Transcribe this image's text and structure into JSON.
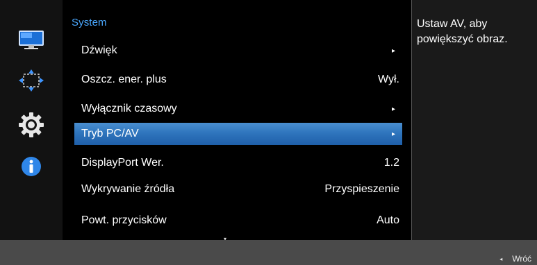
{
  "menu": {
    "title": "System",
    "items": [
      {
        "label": "Dźwięk",
        "value": "",
        "arrow": "▸"
      },
      {
        "label": "Oszcz. ener. plus",
        "value": "Wył.",
        "arrow": ""
      },
      {
        "label": "Wyłącznik czasowy",
        "value": "",
        "arrow": "▸"
      },
      {
        "label": "Tryb PC/AV",
        "value": "",
        "arrow": "▸",
        "selected": true
      },
      {
        "label": "DisplayPort Wer.",
        "value": "1.2",
        "arrow": ""
      },
      {
        "label": "Wykrywanie źródła",
        "value": "Przyspieszenie",
        "arrow": ""
      },
      {
        "label": "Powt. przycisków",
        "value": "Auto",
        "arrow": ""
      }
    ],
    "scroll_indicator": "▾"
  },
  "help": {
    "text": "Ustaw AV, aby powiększyć obraz."
  },
  "sidebar": {
    "icons": [
      "monitor-icon",
      "resize-arrows-icon",
      "gear-icon",
      "info-icon"
    ]
  },
  "footer": {
    "back_arrow": "◂",
    "back_label": "Wróć"
  },
  "colors": {
    "accent": "#4aa8ff",
    "selection": "#2f75bd",
    "background": "#000000",
    "footer": "#4a4a4a"
  }
}
